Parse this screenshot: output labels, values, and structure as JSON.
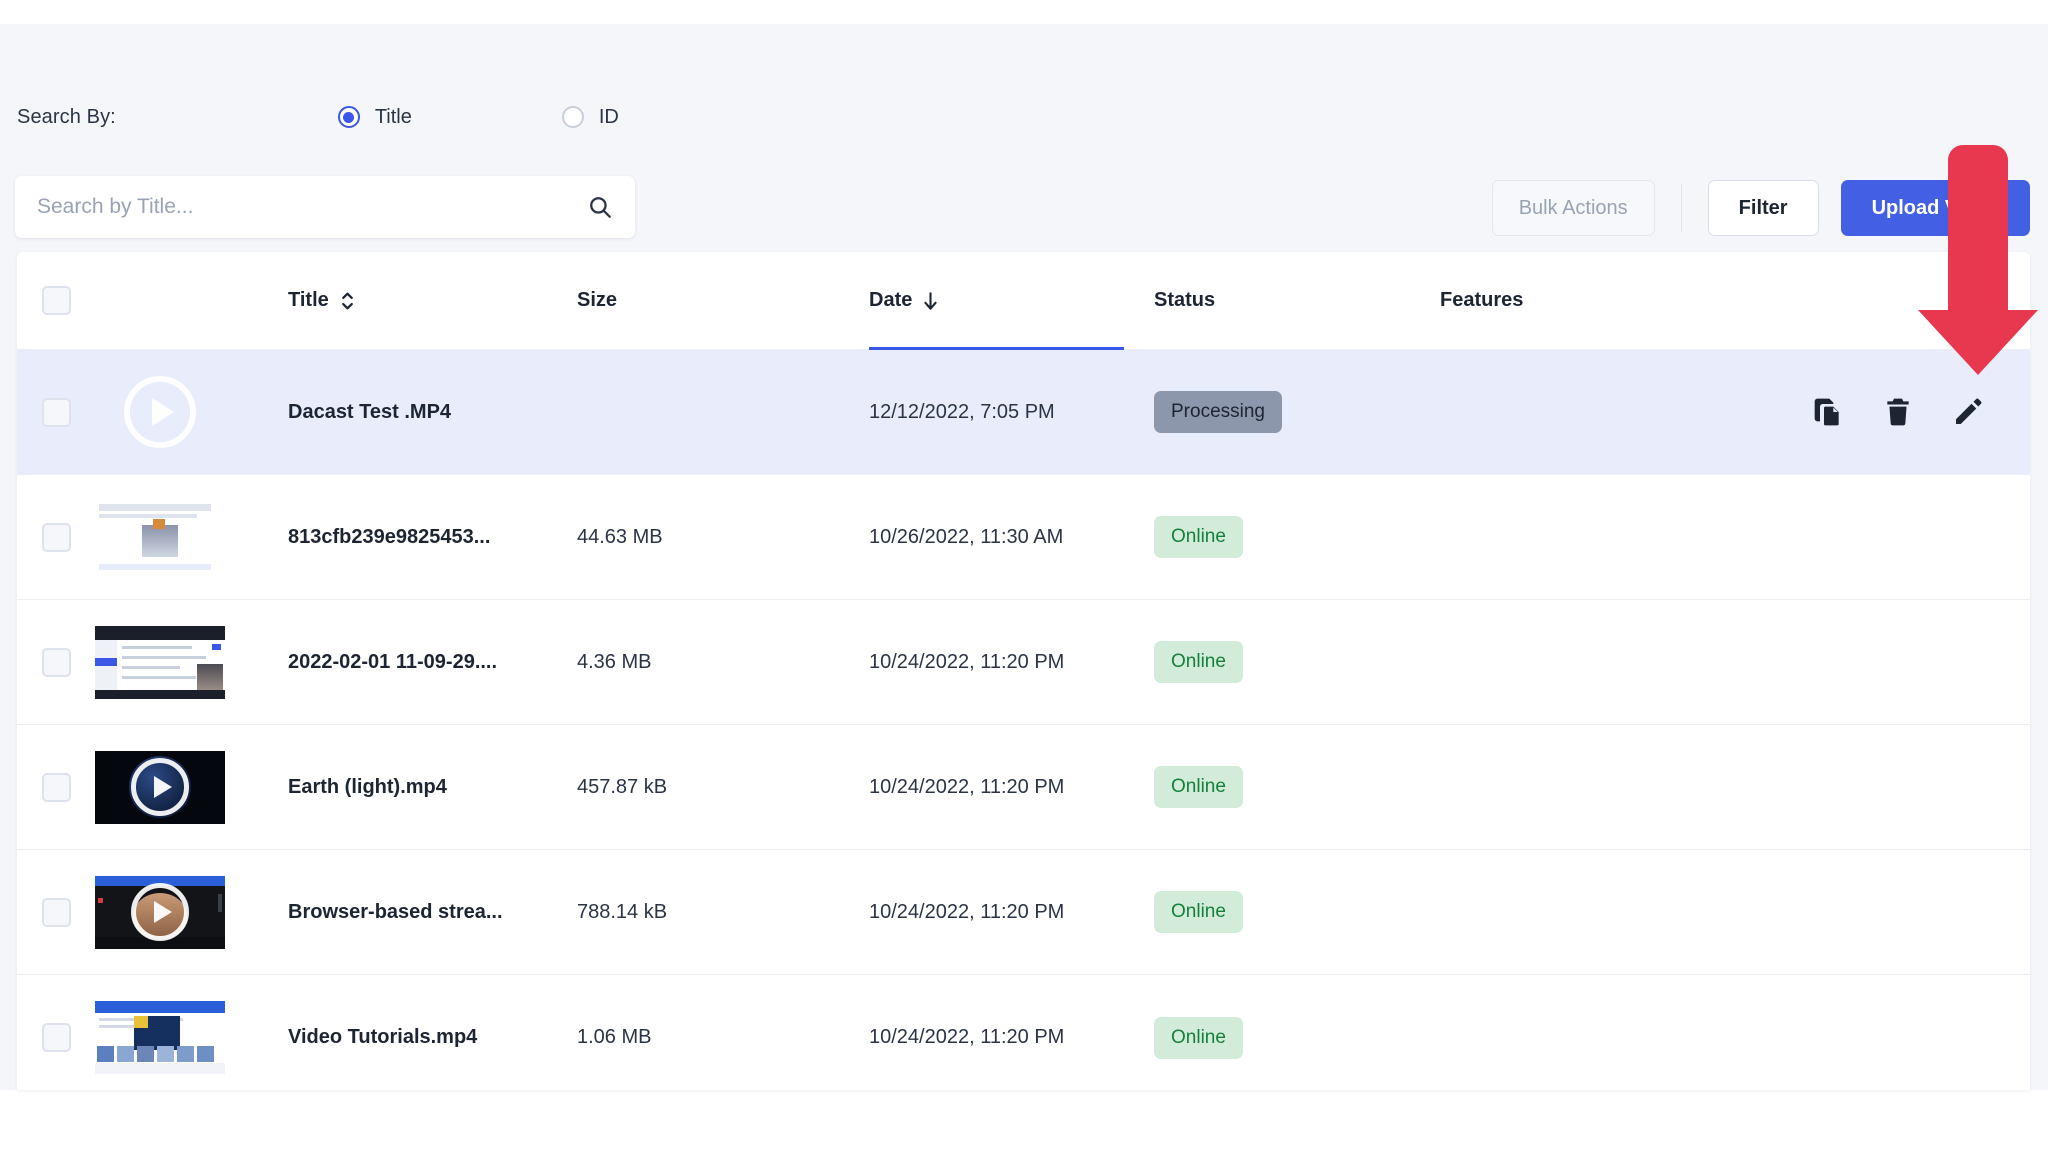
{
  "toolbar": {
    "search_by_label": "Search By:",
    "radio_options": [
      {
        "label": "Title",
        "selected": true
      },
      {
        "label": "ID",
        "selected": false
      }
    ],
    "search_placeholder": "Search by Title...",
    "search_value": "",
    "search_icon": "search-icon",
    "bulk_actions_label": "Bulk Actions",
    "filter_label": "Filter",
    "upload_label": "Upload Video"
  },
  "table": {
    "columns": [
      {
        "key": "checkbox",
        "label": ""
      },
      {
        "key": "thumb",
        "label": ""
      },
      {
        "key": "title",
        "label": "Title",
        "sort_icon": "sort-updown-icon",
        "active": false
      },
      {
        "key": "size",
        "label": "Size"
      },
      {
        "key": "date",
        "label": "Date",
        "sort_icon": "arrow-down-icon",
        "active": true
      },
      {
        "key": "status",
        "label": "Status"
      },
      {
        "key": "features",
        "label": "Features"
      }
    ],
    "rows": [
      {
        "title": "Dacast Test .MP4",
        "size": "",
        "date": "12/12/2022, 7:05 PM",
        "status": "Processing",
        "status_type": "processing",
        "features": "",
        "selected": false,
        "highlighted": true,
        "thumb_kind": "placeholder-play",
        "actions": [
          {
            "name": "duplicate-icon",
            "label": "Duplicate"
          },
          {
            "name": "trash-icon",
            "label": "Delete"
          },
          {
            "name": "pencil-icon",
            "label": "Edit"
          }
        ]
      },
      {
        "title": "813cfb239e9825453...",
        "size": "44.63 MB",
        "date": "10/26/2022, 11:30 AM",
        "status": "Online",
        "status_type": "online",
        "features": "",
        "selected": false,
        "highlighted": false,
        "thumb_kind": "document"
      },
      {
        "title": "2022-02-01 11-09-29....",
        "size": "4.36 MB",
        "date": "10/24/2022, 11:20 PM",
        "status": "Online",
        "status_type": "online",
        "features": "",
        "selected": false,
        "highlighted": false,
        "thumb_kind": "ui-screenshot"
      },
      {
        "title": "Earth (light).mp4",
        "size": "457.87 kB",
        "date": "10/24/2022, 11:20 PM",
        "status": "Online",
        "status_type": "online",
        "features": "",
        "selected": false,
        "highlighted": false,
        "thumb_kind": "earth-play"
      },
      {
        "title": "Browser-based strea...",
        "size": "788.14 kB",
        "date": "10/24/2022, 11:20 PM",
        "status": "Online",
        "status_type": "online",
        "features": "",
        "selected": false,
        "highlighted": false,
        "thumb_kind": "person-play"
      },
      {
        "title": "Video Tutorials.mp4",
        "size": "1.06 MB",
        "date": "10/24/2022, 11:20 PM",
        "status": "Online",
        "status_type": "online",
        "features": "",
        "selected": false,
        "highlighted": false,
        "thumb_kind": "grid-page"
      }
    ]
  },
  "annotation": {
    "arrow_color": "#e8384f",
    "arrow_points_to": "pencil-icon"
  },
  "colors": {
    "accent_blue": "#4360e4",
    "row_highlight": "#e8ecfb",
    "page_background": "#f5f6fa",
    "online_badge_bg": "#d2ecd9",
    "online_badge_text": "#15803d",
    "processing_badge_bg": "#8d97ab"
  }
}
